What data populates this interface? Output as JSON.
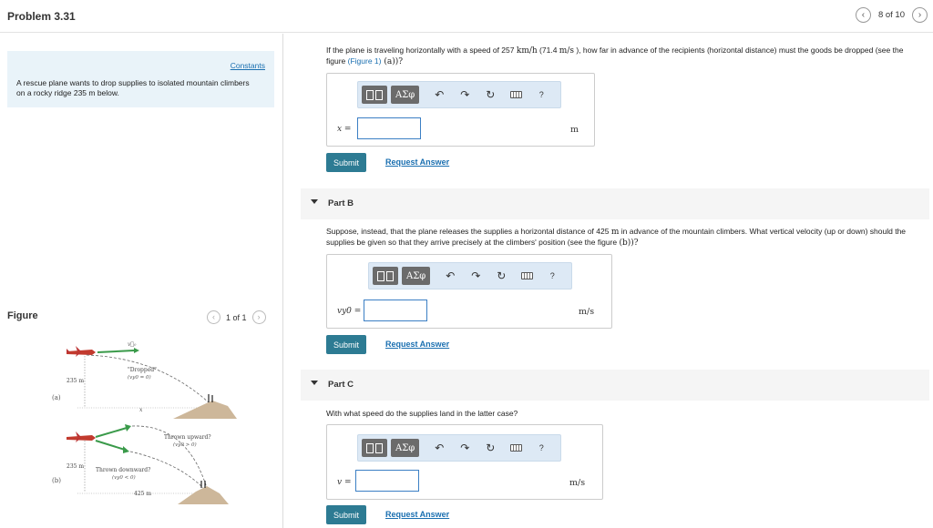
{
  "header": {
    "title": "Problem 3.31",
    "pager_text": "8 of 10",
    "prev_glyph": "‹",
    "next_glyph": "›"
  },
  "problem": {
    "constants_link": "Constants",
    "text": "A rescue plane wants to drop supplies to isolated mountain climbers on a rocky ridge 235 m below."
  },
  "figure": {
    "label": "Figure",
    "pager_text": "1 of 1",
    "a": {
      "tag": "(a)",
      "v_label": "v⃗₀",
      "dropped": "\"Dropped\"",
      "cond": "(vy0 = 0)",
      "height": "235 m",
      "x_label": "x"
    },
    "b": {
      "tag": "(b)",
      "up": "Thrown upward?",
      "up_cond": "(vy0 > 0)",
      "down": "Thrown downward?",
      "down_cond": "(vy0 < 0)",
      "height": "235 m",
      "dist": "425 m"
    }
  },
  "part_a": {
    "question_pre": "If the plane is traveling horizontally with a speed of 257 ",
    "speed_unit": "km/h",
    "question_mid": " (71.4 ",
    "speed_unit2": "m/s",
    "question_post": " ), how far in advance of the recipients (horizontal distance) must the goods be dropped (see the figure ",
    "figure_link": "(Figure 1)",
    "figure_ref": " (a))?",
    "var_label": "x =",
    "unit": "m",
    "submit": "Submit",
    "request": "Request Answer"
  },
  "part_b": {
    "title": "Part B",
    "question_pre": "Suppose, instead, that the plane releases the supplies a horizontal distance of 425 ",
    "dist_unit": "m",
    "question_post": " in advance of the mountain climbers. What vertical velocity (up or down) should the supplies be given so that they arrive precisely at the climbers' position (see the figure ",
    "figure_ref": "(b))?",
    "var_label": "vy0 =",
    "unit": "m/s",
    "submit": "Submit",
    "request": "Request Answer"
  },
  "part_c": {
    "title": "Part C",
    "question": "With what speed do the supplies land in the latter case?",
    "var_label": "v =",
    "unit": "m/s",
    "submit": "Submit",
    "request": "Request Answer"
  },
  "toolbar": {
    "greek": "ΑΣφ",
    "undo": "↶",
    "redo": "↷",
    "reset": "↻",
    "help": "?"
  },
  "colors": {
    "accent": "#2d7b93",
    "link": "#1a6fb0",
    "panel": "#e9f3f9",
    "toolbar": "#dde9f5",
    "input_border": "#3b7fc4"
  }
}
